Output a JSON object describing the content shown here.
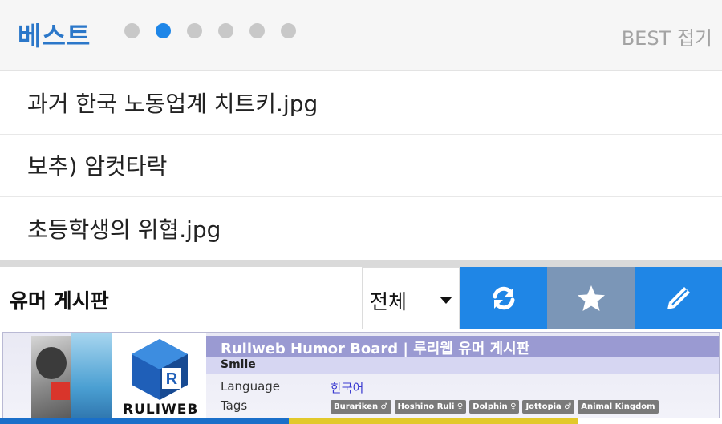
{
  "best": {
    "title": "베스트",
    "toggle_label": "BEST 접기",
    "active_dot": 1,
    "dot_count": 6,
    "items": [
      {
        "label": "과거 한국 노동업계 치트키.jpg"
      },
      {
        "label": "보추) 암컷타락"
      },
      {
        "label": "초등학생의 위협.jpg"
      }
    ]
  },
  "board": {
    "title": "유머 게시판",
    "filter_selected": "전체",
    "buttons": {
      "refresh": "refresh-icon",
      "favorite": "star-icon",
      "write": "pencil-icon"
    }
  },
  "banner": {
    "logo_text": "RULIWEB",
    "title": "Ruliweb Humor Board | 루리웹 유머 게시판",
    "subtitle": "Smile",
    "language_label": "Language",
    "language_value": "한국어",
    "tags_label": "Tags",
    "tags": [
      "Burariken ♂",
      "Hoshino Ruli ♀",
      "Dolphin ♀",
      "Jottopia ♂",
      "Animal Kingdom"
    ]
  },
  "colors": {
    "accent": "#1f86e6",
    "title_blue": "#2b77c9",
    "fav_button": "#7b96b7"
  }
}
